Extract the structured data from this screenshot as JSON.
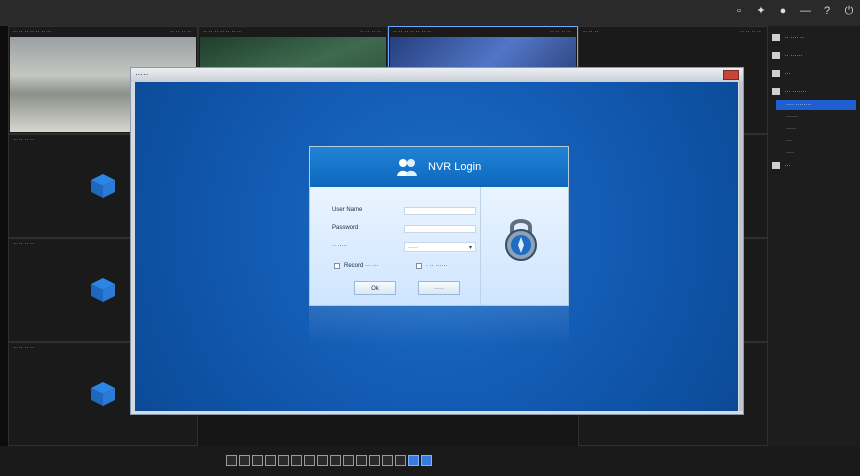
{
  "window": {
    "top_icons": [
      "monitor-icon",
      "settings-icon",
      "user-icon",
      "minimize-icon",
      "help-icon",
      "power-icon"
    ]
  },
  "grid": {
    "cells": [
      {
        "title": "·· ·· ·· ·· ·· ·· ··",
        "meta": "·· ·· ·· ··"
      },
      {
        "title": "·· ·· ·· ·· ·· ·· ··",
        "meta": "·· ·· ·· ··"
      },
      {
        "title": "·· ·· ·· ·· ·· ·· ··",
        "meta": "·· ·· ·· ··"
      },
      {
        "title": "·· ·· ··",
        "meta": "·· ·· ·· ··"
      },
      {
        "title": "·· ·· ·· ··",
        "meta": ""
      },
      {
        "title": "·· ·· ·· ··",
        "meta": ""
      },
      {
        "title": "·· ·· ·· ··",
        "meta": ""
      }
    ]
  },
  "right_panel": {
    "items": [
      {
        "label": "·· ···· ··",
        "icon": "camera-icon"
      },
      {
        "label": "·· ······",
        "icon": "device-icon"
      },
      {
        "label": "···",
        "icon": "list-icon"
      },
      {
        "label": "··· ·······",
        "icon": "wrench-icon"
      }
    ],
    "subitems": [
      {
        "label": "···· ········",
        "active": true
      },
      {
        "label": "······",
        "active": false
      },
      {
        "label": "·····",
        "active": false
      },
      {
        "label": "···",
        "active": false
      },
      {
        "label": "····",
        "active": false
      }
    ],
    "last_item": {
      "label": "···",
      "icon": "pen-icon"
    }
  },
  "dialog": {
    "title": "·····",
    "login": {
      "title": "NVR Login",
      "user_name_label": "User Name",
      "password_label": "Password",
      "select_label": "·· ·····",
      "select_value": "·····",
      "checkbox1_label": "Record ··· ···",
      "checkbox2_label": "· ·· ······",
      "ok_label": "Ok",
      "cancel_label": "·····"
    }
  },
  "bottom_toolbar": {
    "tool_count": 16,
    "active_tools": [
      14,
      15
    ]
  }
}
